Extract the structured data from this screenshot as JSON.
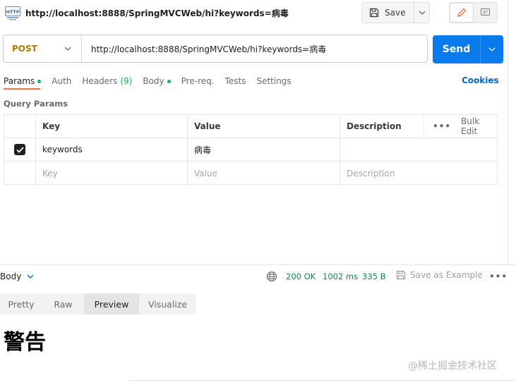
{
  "header": {
    "icon_label": "HTTP",
    "title": "http://localhost:8888/SpringMVCWeb/hi?keywords=病毒",
    "save_label": "Save"
  },
  "request": {
    "method": "POST",
    "url": "http://localhost:8888/SpringMVCWeb/hi?keywords=病毒",
    "send_label": "Send"
  },
  "tabs": [
    {
      "label": "Params",
      "dot": true,
      "active": true
    },
    {
      "label": "Auth"
    },
    {
      "label": "Headers",
      "count": "(9)"
    },
    {
      "label": "Body",
      "dot": true
    },
    {
      "label": "Pre-req."
    },
    {
      "label": "Tests"
    },
    {
      "label": "Settings"
    }
  ],
  "cookies_label": "Cookies",
  "query_params": {
    "title": "Query Params",
    "columns": {
      "key": "Key",
      "value": "Value",
      "description": "Description",
      "bulk_edit": "Bulk Edit"
    },
    "rows": [
      {
        "checked": true,
        "key": "keywords",
        "value": "病毒",
        "description": ""
      }
    ],
    "placeholder": {
      "key": "Key",
      "value": "Value",
      "description": "Description"
    }
  },
  "response": {
    "body_label": "Body",
    "status": "200 OK",
    "time": "1002 ms",
    "size": "335 B",
    "save_example": "Save as Example",
    "view_tabs": [
      "Pretty",
      "Raw",
      "Preview",
      "Visualize"
    ],
    "active_view": "Preview",
    "preview_heading": "警告"
  },
  "watermark": "@稀土掘金技术社区",
  "colors": {
    "send": "#097bed",
    "method": "#ad7a03",
    "status": "#0f8a45",
    "active_tab": "#ff6c37",
    "dot": "#0cbb52",
    "link": "#0265d2"
  }
}
